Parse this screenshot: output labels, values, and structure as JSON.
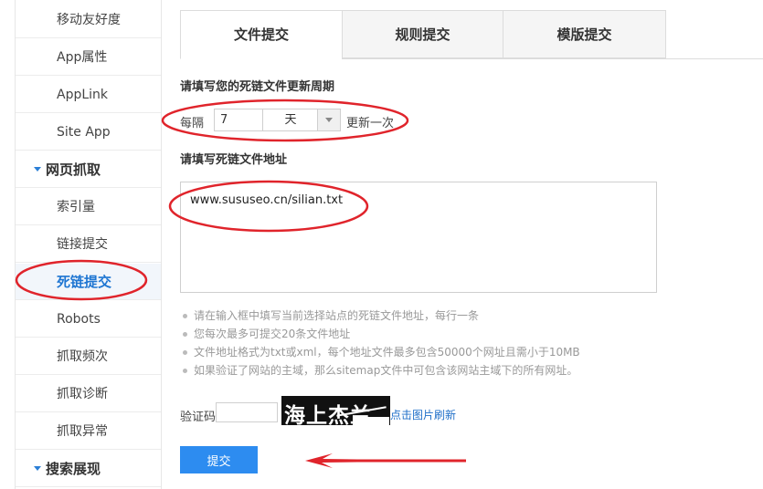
{
  "sidebar": {
    "items": [
      {
        "label": "移动友好度",
        "type": "item"
      },
      {
        "label": "App属性",
        "type": "item"
      },
      {
        "label": "AppLink",
        "type": "item"
      },
      {
        "label": "Site App",
        "type": "item"
      },
      {
        "label": "网页抓取",
        "type": "group"
      },
      {
        "label": "索引量",
        "type": "item"
      },
      {
        "label": "链接提交",
        "type": "item"
      },
      {
        "label": "死链提交",
        "type": "item",
        "active": true
      },
      {
        "label": "Robots",
        "type": "item"
      },
      {
        "label": "抓取频次",
        "type": "item"
      },
      {
        "label": "抓取诊断",
        "type": "item"
      },
      {
        "label": "抓取异常",
        "type": "item"
      },
      {
        "label": "搜索展现",
        "type": "group"
      }
    ]
  },
  "tabs": [
    {
      "label": "文件提交",
      "active": true
    },
    {
      "label": "规则提交"
    },
    {
      "label": "模版提交"
    }
  ],
  "form": {
    "period_title": "请填写您的死链文件更新周期",
    "every_label": "每隔",
    "interval_value": "7",
    "interval_unit": "天",
    "update_once": "更新一次",
    "url_title": "请填写死链文件地址",
    "url_value": "www.sususeo.cn/silian.txt",
    "tips": [
      "请在输入框中填写当前选择站点的死链文件地址，每行一条",
      "您每次最多可提交20条文件地址",
      "文件地址格式为txt或xml，每个地址文件最多包含50000个网址且需小于10MB",
      "如果验证了网站的主域，那么sitemap文件中可包含该网站主域下的所有网址。"
    ],
    "captcha_label": "验证码",
    "captcha_value": "",
    "captcha_image_text": "海上杰兰",
    "refresh_label": "点击图片刷新",
    "submit_label": "提交"
  },
  "annotations": {
    "ellipse_color": "#e0242b",
    "arrow_color": "#e0242b"
  }
}
